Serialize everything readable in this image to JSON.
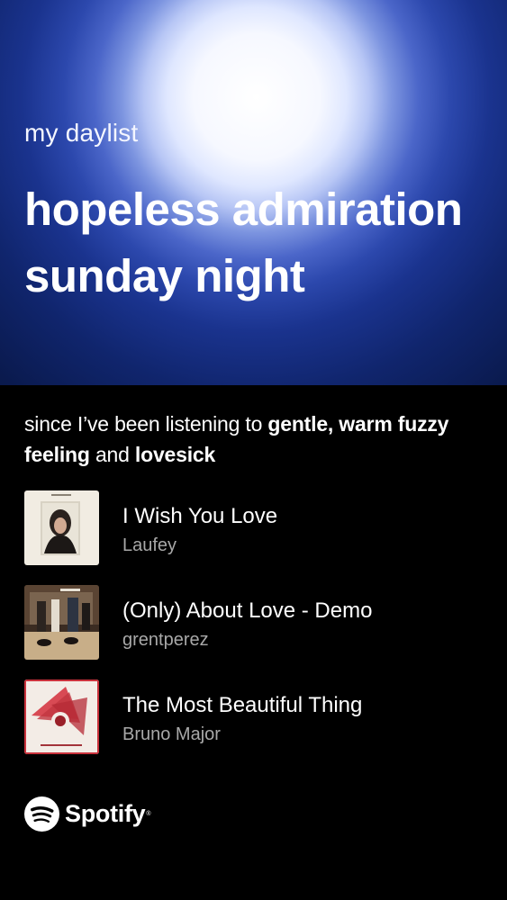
{
  "header": {
    "subtitle": "my daylist",
    "title": "hopeless admiration sunday night"
  },
  "reason": {
    "prefix": "since I’ve been listening to",
    "genre_1": "gentle, warm fuzzy feeling",
    "joiner": "and",
    "genre_2": "lovesick"
  },
  "tracks": [
    {
      "title": "I Wish You Love",
      "artist": "Laufey"
    },
    {
      "title": "(Only) About Love - Demo",
      "artist": "grentperez"
    },
    {
      "title": "The Most Beautiful Thing",
      "artist": "Bruno Major"
    }
  ],
  "footer": {
    "brand": "Spotify",
    "icon": "spotify-logo-icon"
  },
  "colors": {
    "background": "#000000",
    "gradient_center": "#ffffff",
    "gradient_edge": "#071336",
    "secondary_text": "#a8a8a8"
  }
}
